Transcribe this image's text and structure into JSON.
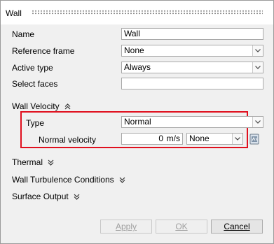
{
  "window": {
    "title": "Wall"
  },
  "form": {
    "name_label": "Name",
    "name_value": "Wall",
    "reference_frame_label": "Reference frame",
    "reference_frame_value": "None",
    "active_type_label": "Active type",
    "active_type_value": "Always",
    "select_faces_label": "Select faces",
    "select_faces_value": ""
  },
  "wall_velocity": {
    "header": "Wall Velocity",
    "expanded": true,
    "type_label": "Type",
    "type_value": "Normal",
    "normal_velocity_label": "Normal velocity",
    "normal_velocity_value": "0",
    "normal_velocity_unit": "m/s",
    "expression_value": "None"
  },
  "sections": {
    "thermal": "Thermal",
    "wall_turbulence": "Wall Turbulence Conditions",
    "surface_output": "Surface Output"
  },
  "buttons": {
    "apply": "Apply",
    "ok": "OK",
    "cancel": "Cancel"
  },
  "colors": {
    "highlight_border": "#e0101e",
    "dialog_bg": "#f0f0f0"
  }
}
